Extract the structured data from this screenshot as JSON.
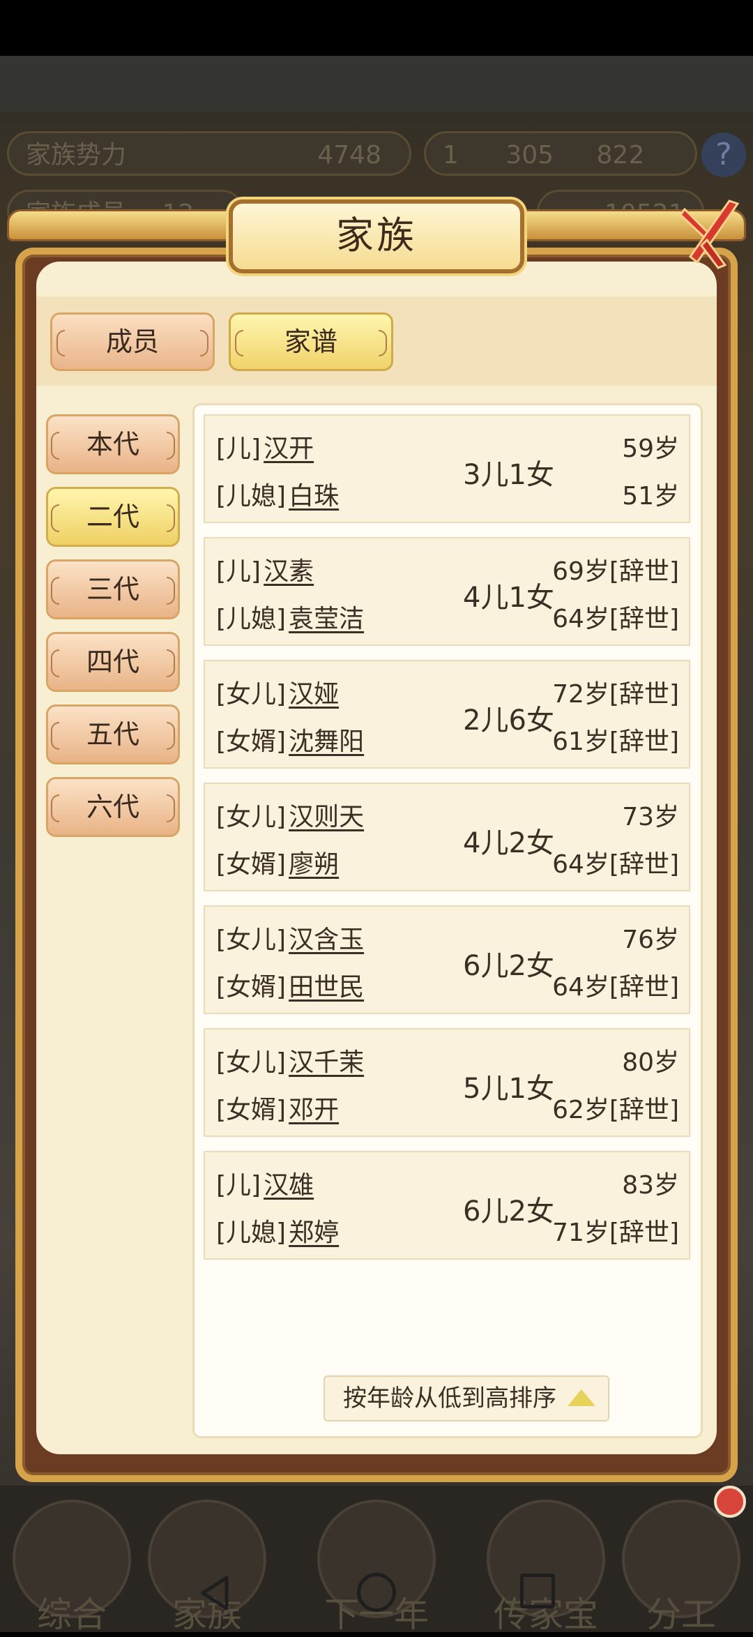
{
  "background": {
    "stats": {
      "power_label": "家族势力",
      "power_value": "4748",
      "gold": "1",
      "silver": "305",
      "coins": "822",
      "members_label": "家族成员",
      "members_value": "12",
      "wealth_value": "10521"
    },
    "help_label": "?"
  },
  "dialog": {
    "title": "家族",
    "tabs": [
      "成员",
      "家谱"
    ],
    "active_tab": "家谱",
    "generations": [
      "本代",
      "二代",
      "三代",
      "四代",
      "五代",
      "六代"
    ],
    "active_generation": "二代",
    "rows": [
      {
        "rel1": "[儿]",
        "name1": "汉开",
        "age1": "59岁",
        "rel2": "[儿媳]",
        "name2": "白珠",
        "age2": "51岁",
        "children": "3儿1女"
      },
      {
        "rel1": "[儿]",
        "name1": "汉素",
        "age1": "69岁[辞世]",
        "rel2": "[儿媳]",
        "name2": "袁莹洁",
        "age2": "64岁[辞世]",
        "children": "4儿1女"
      },
      {
        "rel1": "[女儿]",
        "name1": "汉娅",
        "age1": "72岁[辞世]",
        "rel2": "[女婿]",
        "name2": "沈舞阳",
        "age2": "61岁[辞世]",
        "children": "2儿6女"
      },
      {
        "rel1": "[女儿]",
        "name1": "汉则天",
        "age1": "73岁",
        "rel2": "[女婿]",
        "name2": "廖朔",
        "age2": "64岁[辞世]",
        "children": "4儿2女"
      },
      {
        "rel1": "[女儿]",
        "name1": "汉含玉",
        "age1": "76岁",
        "rel2": "[女婿]",
        "name2": "田世民",
        "age2": "64岁[辞世]",
        "children": "6儿2女"
      },
      {
        "rel1": "[女儿]",
        "name1": "汉千茉",
        "age1": "80岁",
        "rel2": "[女婿]",
        "name2": "邓开",
        "age2": "62岁[辞世]",
        "children": "5儿1女"
      },
      {
        "rel1": "[儿]",
        "name1": "汉雄",
        "age1": "83岁",
        "rel2": "[儿媳]",
        "name2": "郑婷",
        "age2": "71岁[辞世]",
        "children": "6儿2女"
      }
    ],
    "sort_label": "按年龄从低到高排序"
  },
  "bottom_menu": [
    "综合",
    "家族",
    "下一年",
    "传家宝",
    "分工"
  ],
  "colors": {
    "accent_gold": "#f0d26a",
    "tab_peach": "#eab48a",
    "panel_cream": "#f8efd3",
    "frame_brown": "#6b3b22",
    "close_red": "#d9382e"
  }
}
